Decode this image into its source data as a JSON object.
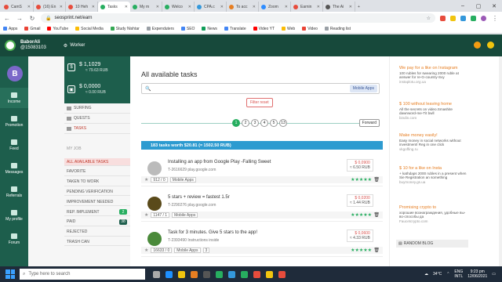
{
  "browser": {
    "tabs": [
      {
        "label": "CamS",
        "color": "#e74c3c",
        "active": false
      },
      {
        "label": "(16) En",
        "color": "#e74c3c",
        "active": false
      },
      {
        "label": "10 Heh",
        "color": "#e74c3c",
        "active": false
      },
      {
        "label": "Tasks",
        "color": "#27ae60",
        "active": true
      },
      {
        "label": "My m",
        "color": "#27ae60",
        "active": false
      },
      {
        "label": "Welco",
        "color": "#27ae60",
        "active": false
      },
      {
        "label": "CPA.c",
        "color": "#3498db",
        "active": false
      },
      {
        "label": "To acc",
        "color": "#e67e22",
        "active": false
      },
      {
        "label": "Zoom",
        "color": "#2d8cff",
        "active": false
      },
      {
        "label": "Earnin",
        "color": "#e74c3c",
        "active": false
      },
      {
        "label": "The Ai",
        "color": "#555",
        "active": false
      }
    ],
    "url": "seosprint.net/earn",
    "bookmarks": [
      "Apps",
      "Gmail",
      "YouTube",
      "Social Media",
      "Study Nishtar",
      "Expenduters",
      "SEO",
      "News",
      "Translate",
      "Video YT",
      "Web",
      "Video",
      "Reading list"
    ]
  },
  "header": {
    "username": "BaborAli",
    "userid": "@15083103",
    "role": "Worker"
  },
  "avatar": {
    "letter": "B"
  },
  "iconnav": [
    {
      "label": "Income",
      "active": true
    },
    {
      "label": "Promotion",
      "active": false
    },
    {
      "label": "Feed",
      "active": false
    },
    {
      "label": "Messages",
      "active": false
    },
    {
      "label": "Referrals",
      "active": false
    },
    {
      "label": "My profile",
      "active": false
    },
    {
      "label": "Forum",
      "active": false
    }
  ],
  "balance": {
    "main": "$ 1,1029",
    "main_sub": "≈ 79.63 RUB",
    "ads": "$ 0,0000",
    "ads_sub": "≈ 0.00 RUB"
  },
  "sidenav": {
    "top": [
      "SURFING",
      "QUESTS",
      "TASKS"
    ],
    "section_title": "MY JOB",
    "items": [
      {
        "label": "ALL AVAILABLE TASKS",
        "badge": "",
        "hl": true
      },
      {
        "label": "FAVORITE",
        "badge": ""
      },
      {
        "label": "TAKEN TO WORK",
        "badge": ""
      },
      {
        "label": "PENDING VERIFICATION",
        "badge": ""
      },
      {
        "label": "IMPROVEMENT NEEDED",
        "badge": ""
      },
      {
        "label": "REP. IMPLEMENT",
        "badge": "2"
      },
      {
        "label": "PAID",
        "badge": "38",
        "dark": true
      },
      {
        "label": "REJECTED",
        "badge": ""
      },
      {
        "label": "TRASH CAN",
        "badge": ""
      }
    ]
  },
  "main": {
    "title": "All available tasks",
    "mobile_apps": "Mobile Apps",
    "filter_reset": "Filter reset",
    "pages": [
      "1",
      "2",
      "3",
      "4",
      "5",
      "13"
    ],
    "forward": "Forward",
    "banner": "183 tasks worth $20.81 (≈ 1502.50 RUB)",
    "tasks": [
      {
        "title": "Installing an app from Google Play -Falling Sweet",
        "id": "T-2616629",
        "site": "play.google.com",
        "price": "$ 0,0900",
        "price_rub": "≈ 6.50 RUB",
        "count": "912 / 0",
        "tag": "Mobile Apps",
        "extra": "",
        "avatar": "#bbb",
        "stars": "★★★★★"
      },
      {
        "title": "5 stars + review = fastest 1.5r",
        "id": "T-2290276",
        "site": "play.google.com",
        "price": "$ 0,0200",
        "price_rub": "≈ 1.44 RUB",
        "count": "1147 / 1",
        "tag": "Mobile Apps",
        "extra": "",
        "avatar": "#5a4a1a",
        "stars": "★★★★★"
      },
      {
        "title": "Task for 3 minutes. Give 5 stars to the app!",
        "id": "T-2393490",
        "site": "Instructions inside",
        "price": "$ 0,0600",
        "price_rub": "≈ 4.33 RUB",
        "count": "16633 / 0",
        "tag": "Mobile Apps",
        "extra": "3",
        "avatar": "#4a8a3a",
        "stars": "★★★★★"
      }
    ]
  },
  "ads": [
    {
      "title": "We pay for a like on Instagram",
      "body": "100 rubles for swearing 2000 ruble at answer for re-G-country-Svy",
      "link": "instaplotu.org.ua",
      "color": "#e67e22"
    },
    {
      "title": "$ 100 without leaving home",
      "body": "All the secrets on video.Smashite dawnword-me-Tit bwll",
      "link": "bindin.com",
      "color": "#e67e22"
    },
    {
      "title": "Make money easily!",
      "body": "Easy money in social networks without investment! Reg in one click",
      "link": "vkgoffing.ru",
      "color": "#e67e22"
    },
    {
      "title": "$ 10 for a like on Insta",
      "body": "+ kathdaps 2000 rubles in a present when Sie Registration an something",
      "link": "buymoney.gs.ua",
      "color": "#e67e22"
    },
    {
      "title": "Promising crypto to",
      "body": "хорошие вознаграждения, удобные вы-во-способы да",
      "link": "Faucetcrypto.com",
      "color": "#e67e22"
    }
  ],
  "random_blog": "RANDOM BLOG",
  "taskbar": {
    "search": "Type here to search",
    "temp": "34°C",
    "lang": "ENG",
    "lang2": "INTL",
    "time": "9:23 pm",
    "date": "12/06/2021"
  }
}
